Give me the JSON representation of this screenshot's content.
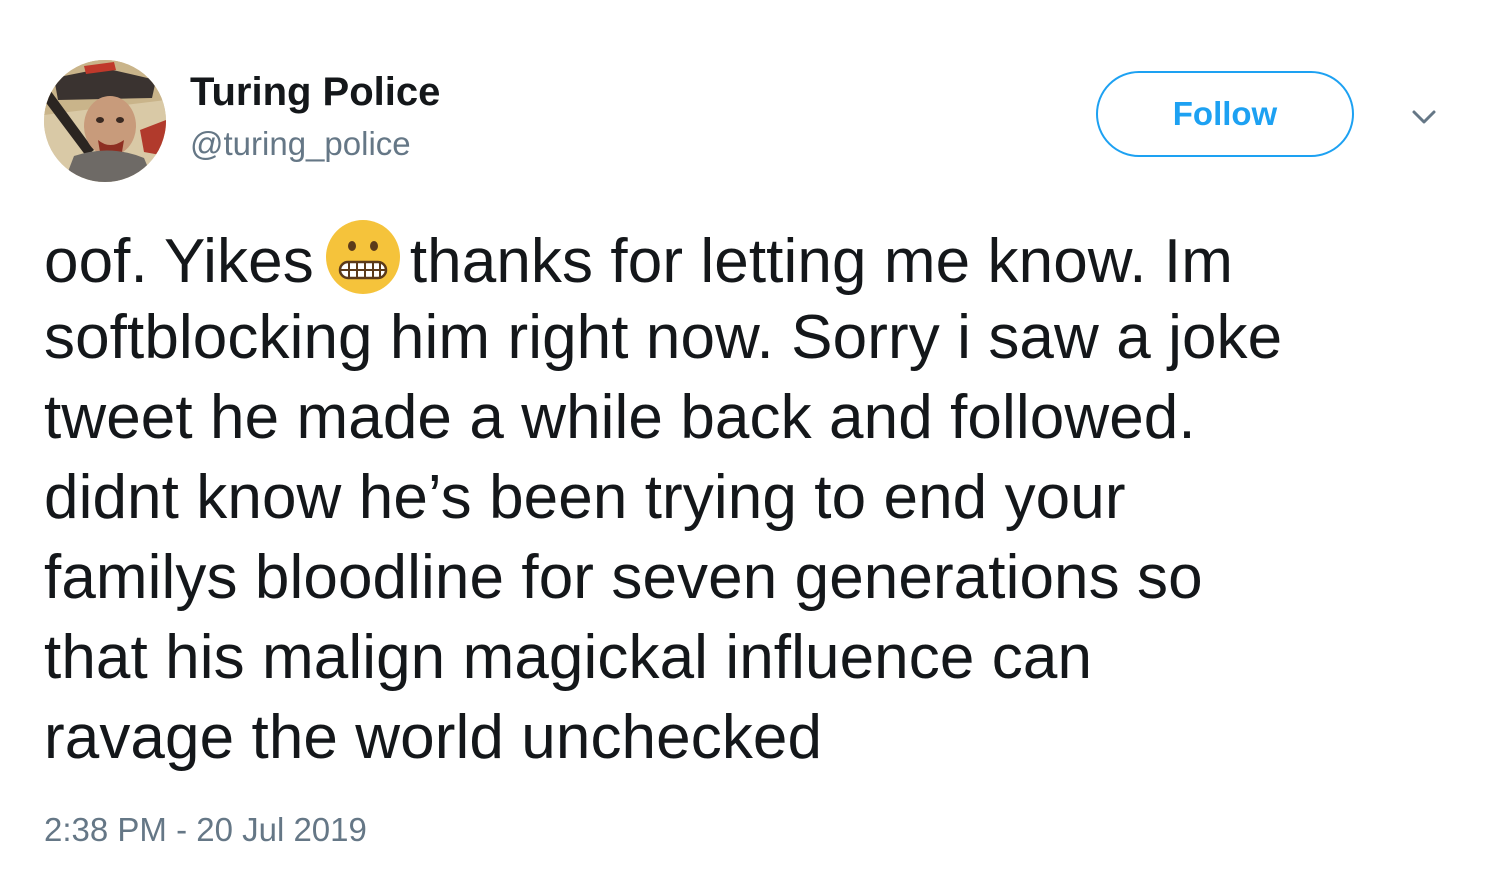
{
  "user": {
    "display_name": "Turing Police",
    "handle": "@turing_police",
    "avatar_icon": "profile-avatar"
  },
  "actions": {
    "follow_label": "Follow",
    "menu_icon": "chevron-down-icon"
  },
  "tweet": {
    "line1_before_emoji": "oof. Yikes",
    "emoji_icon": "grimacing-face-emoji",
    "line1_after_emoji": "thanks for letting me know. Im",
    "lines": [
      "softblocking him right now. Sorry i saw a joke",
      "tweet he made a while back and followed.",
      "didnt know he’s been trying to end your",
      "familys bloodline for seven generations so",
      "that his malign magickal influence can",
      "ravage the world unchecked"
    ],
    "timestamp": "2:38 PM - 20 Jul 2019"
  },
  "colors": {
    "accent": "#1da1f2",
    "text": "#14171a",
    "muted": "#657786",
    "emoji": "#f5c33b"
  }
}
